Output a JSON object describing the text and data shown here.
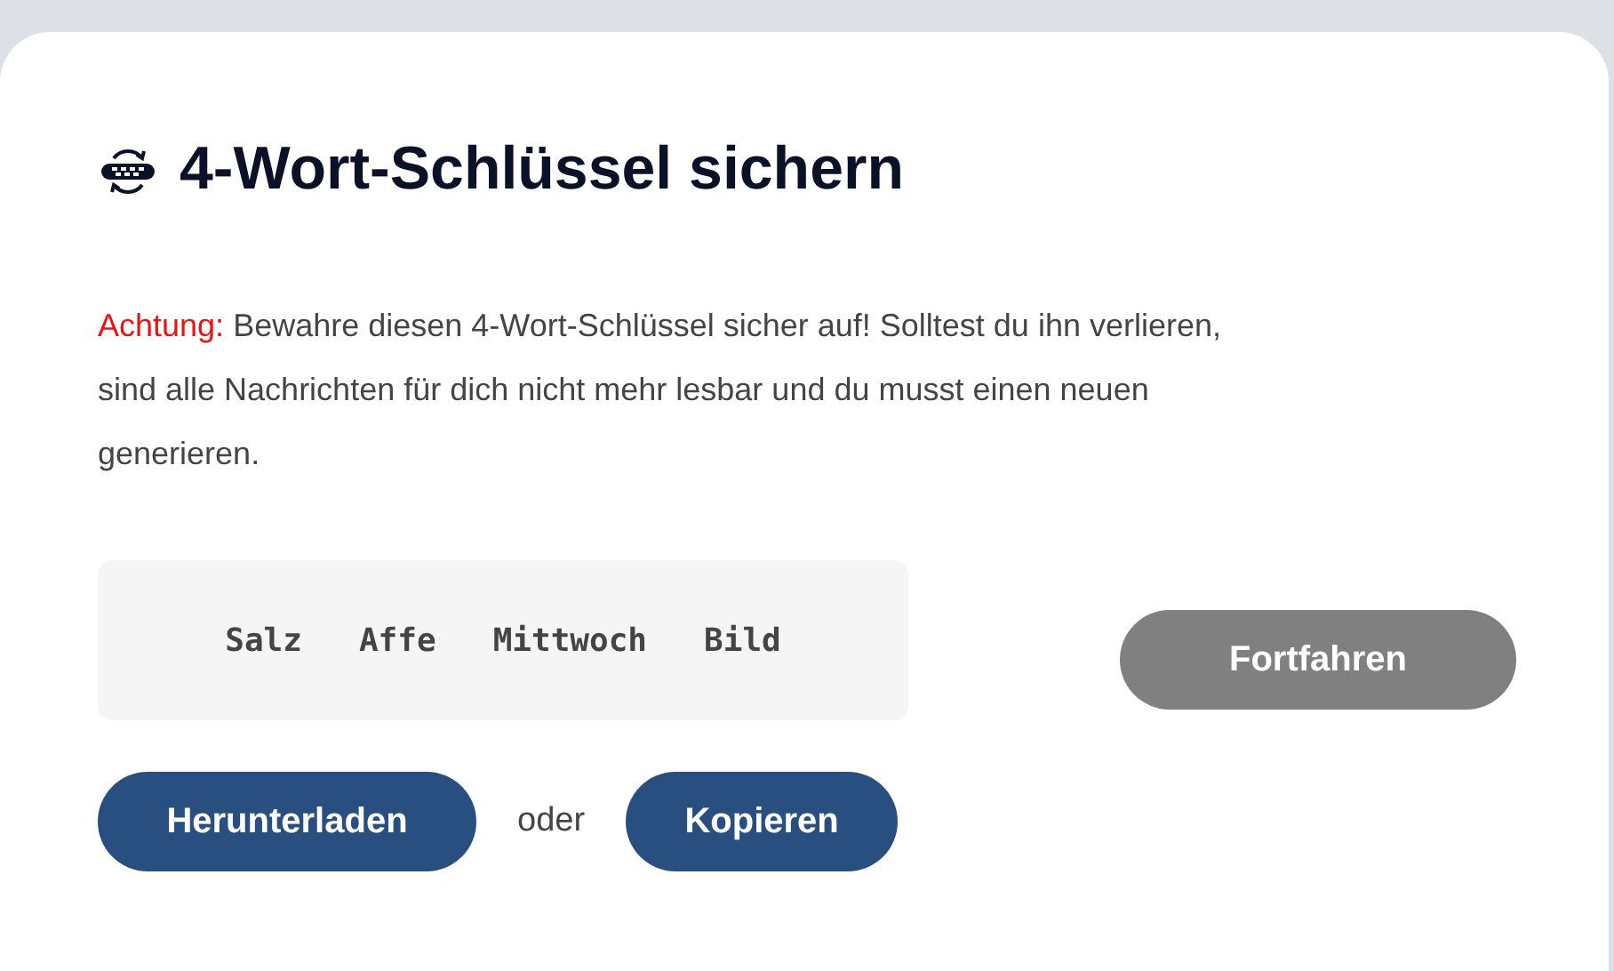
{
  "dialog": {
    "title": "4-Wort-Schlüssel sichern",
    "warning": {
      "label": "Achtung:",
      "text": "Bewahre diesen 4-Wort-Schlüssel sicher auf! Solltest du ihn verlieren, sind alle Nachrichten für dich nicht mehr lesbar und du musst einen neuen generieren."
    },
    "key_words": [
      "Salz",
      "Affe",
      "Mittwoch",
      "Bild"
    ],
    "download_button": "Herunterladen",
    "separator": "oder",
    "copy_button": "Kopieren",
    "continue_button": {
      "label": "Fortfahren",
      "disabled": true
    }
  }
}
